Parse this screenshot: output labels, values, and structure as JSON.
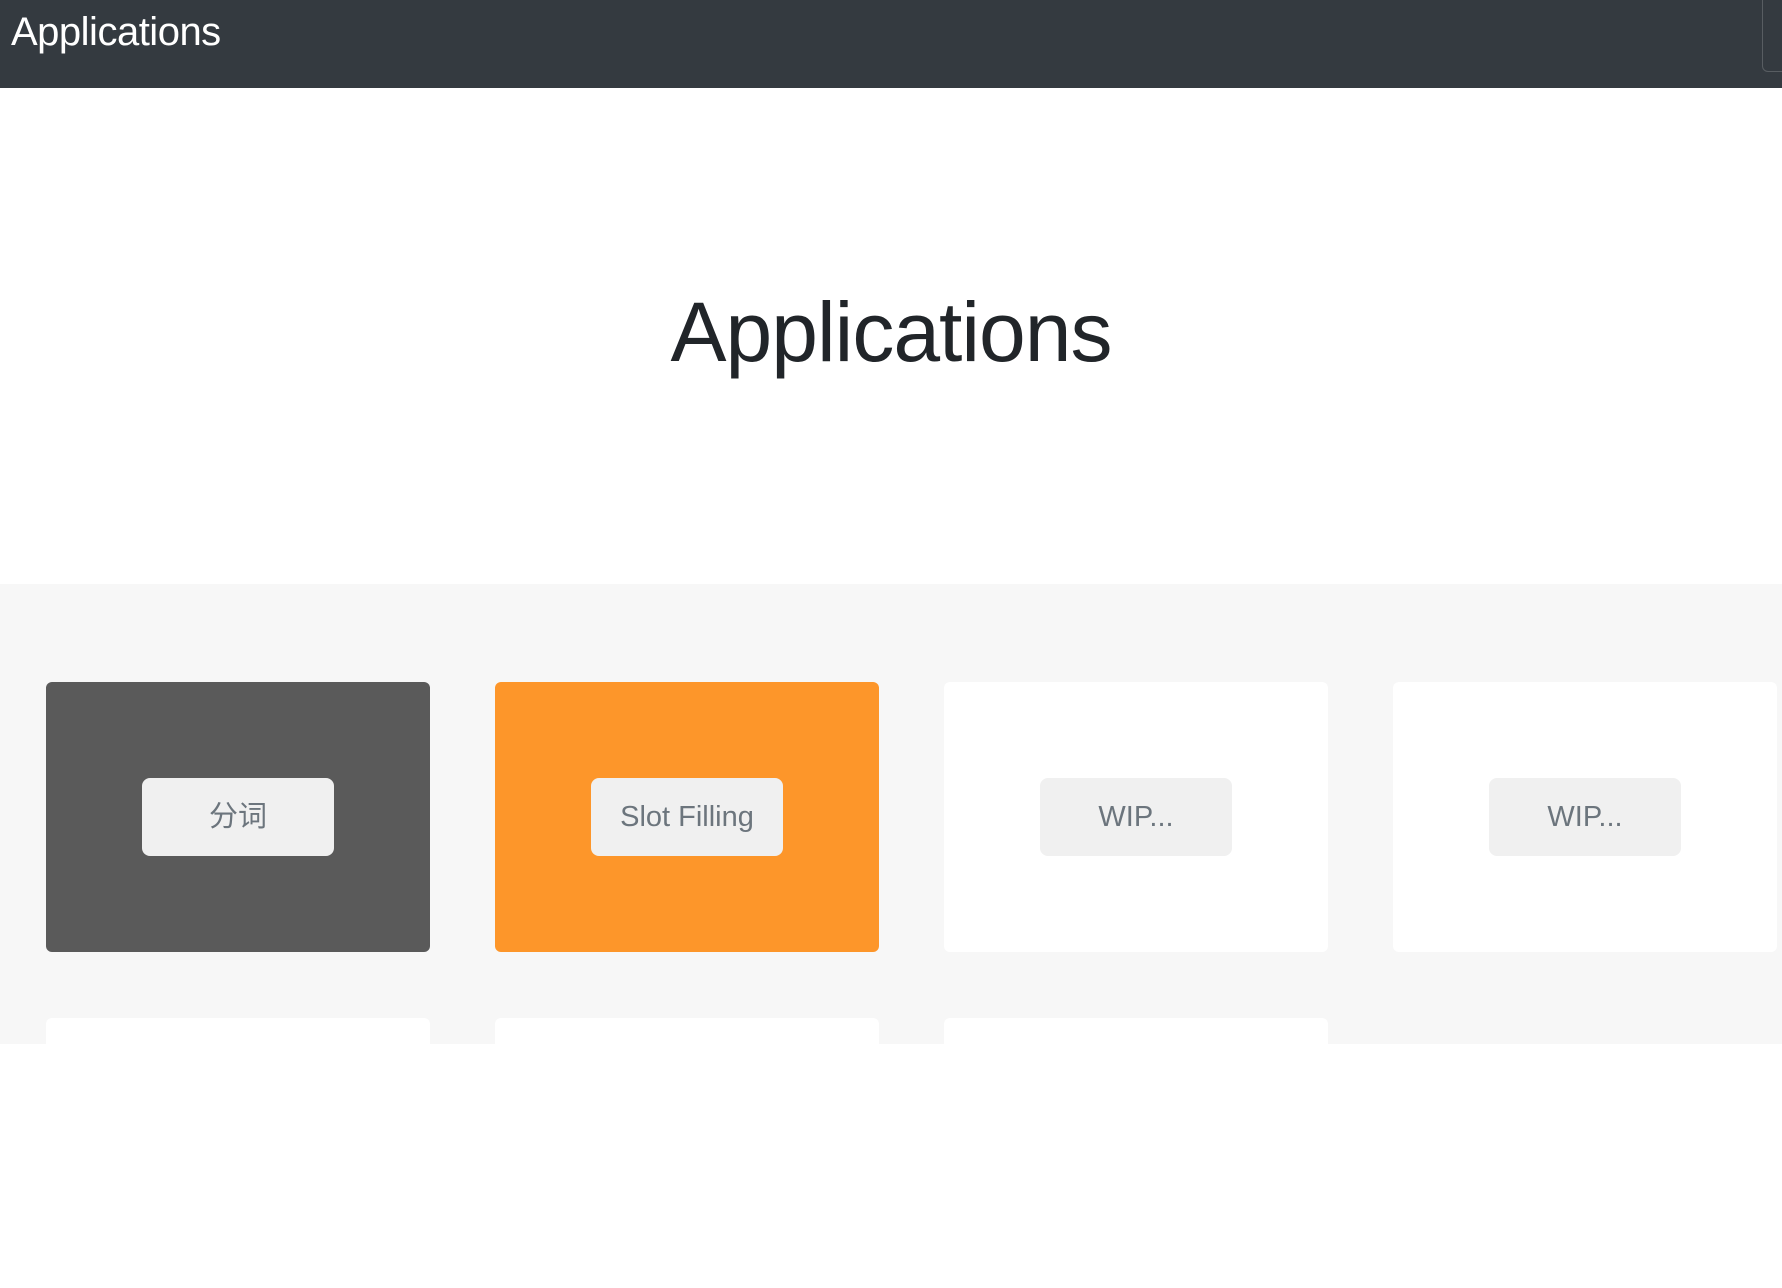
{
  "navbar": {
    "brand": "Applications"
  },
  "jumbotron": {
    "heading": "Applications"
  },
  "colors": {
    "navbar_bg": "#343a40",
    "card_dark": "#5a5a5a",
    "card_orange": "#fd962a",
    "card_white": "#ffffff",
    "button_bg": "#f0f0f0",
    "button_text": "#6c757d",
    "album_bg": "#f7f7f7"
  },
  "cards": [
    {
      "label": "分词",
      "color": "#5a5a5a"
    },
    {
      "label": "Slot Filling",
      "color": "#fd962a"
    },
    {
      "label": "WIP...",
      "color": "#ffffff"
    },
    {
      "label": "WIP...",
      "color": "#ffffff"
    },
    {
      "label": "",
      "color": "#ffffff"
    },
    {
      "label": "",
      "color": "#ffffff"
    },
    {
      "label": "",
      "color": "#ffffff"
    }
  ]
}
